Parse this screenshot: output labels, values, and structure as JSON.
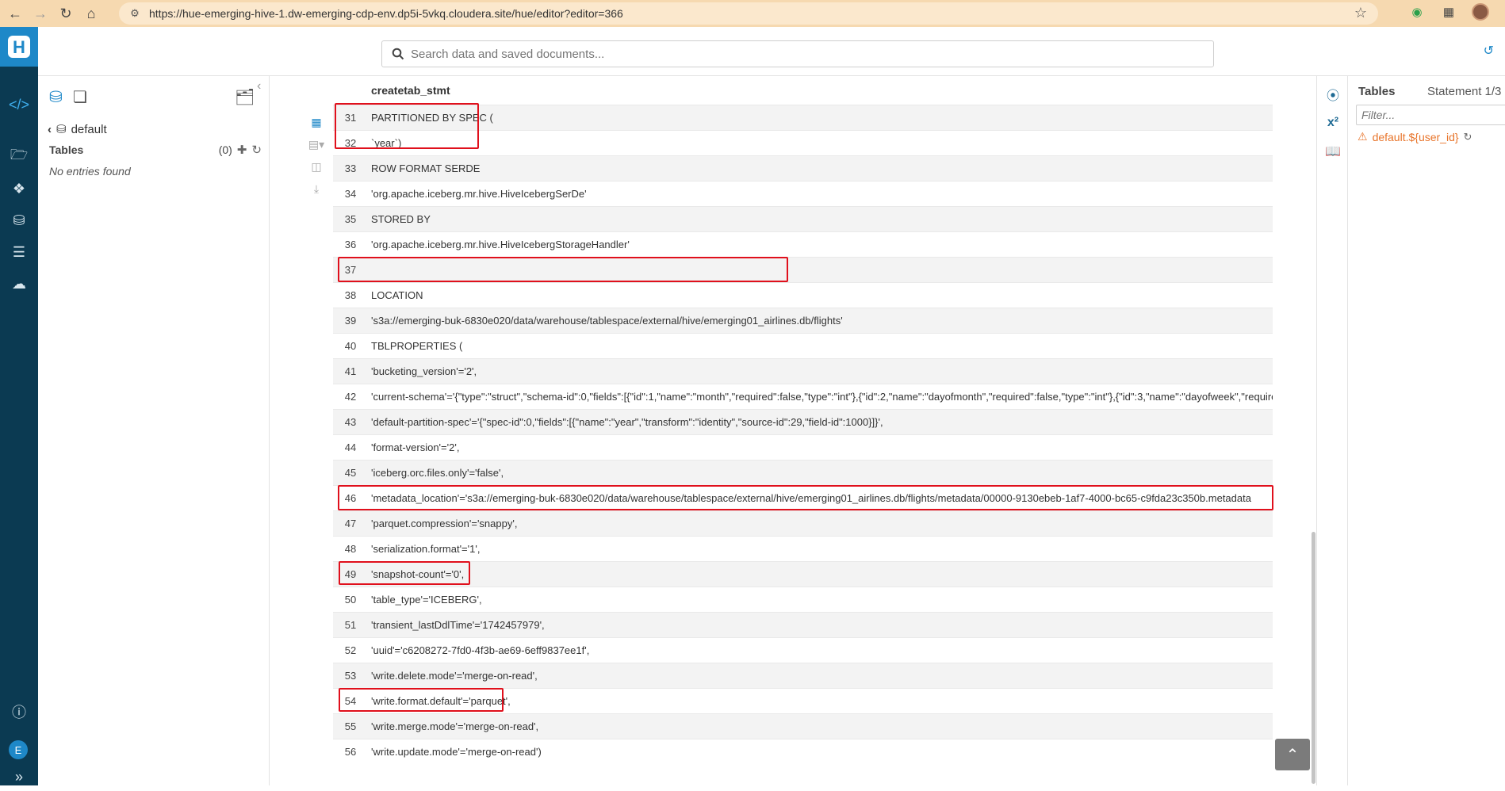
{
  "browser": {
    "url": "https://hue-emerging-hive-1.dw-emerging-cdp-env.dp5i-5vkq.cloudera.site/hue/editor?editor=366"
  },
  "topbar": {
    "search_placeholder": "Search data and saved documents..."
  },
  "assist": {
    "database": "default",
    "tables_label": "Tables",
    "tables_count": "(0)",
    "empty_text": "No entries found"
  },
  "result": {
    "column_header": "createtab_stmt",
    "rows": [
      {
        "num": "31",
        "value": "PARTITIONED BY SPEC ("
      },
      {
        "num": "32",
        "value": "`year`)"
      },
      {
        "num": "33",
        "value": "ROW FORMAT SERDE"
      },
      {
        "num": "34",
        "value": "'org.apache.iceberg.mr.hive.HiveIcebergSerDe'"
      },
      {
        "num": "35",
        "value": "STORED BY"
      },
      {
        "num": "36",
        "value": "'org.apache.iceberg.mr.hive.HiveIcebergStorageHandler'"
      },
      {
        "num": "37",
        "value": ""
      },
      {
        "num": "38",
        "value": "LOCATION"
      },
      {
        "num": "39",
        "value": "'s3a://emerging-buk-6830e020/data/warehouse/tablespace/external/hive/emerging01_airlines.db/flights'"
      },
      {
        "num": "40",
        "value": "TBLPROPERTIES ("
      },
      {
        "num": "41",
        "value": "'bucketing_version'='2',"
      },
      {
        "num": "42",
        "value": "'current-schema'='{\"type\":\"struct\",\"schema-id\":0,\"fields\":[{\"id\":1,\"name\":\"month\",\"required\":false,\"type\":\"int\"},{\"id\":2,\"name\":\"dayofmonth\",\"required\":false,\"type\":\"int\"},{\"id\":3,\"name\":\"dayofweek\",\"required\":fal"
      },
      {
        "num": "43",
        "value": "'default-partition-spec'='{\"spec-id\":0,\"fields\":[{\"name\":\"year\",\"transform\":\"identity\",\"source-id\":29,\"field-id\":1000}]}',"
      },
      {
        "num": "44",
        "value": "'format-version'='2',"
      },
      {
        "num": "45",
        "value": "'iceberg.orc.files.only'='false',"
      },
      {
        "num": "46",
        "value": "'metadata_location'='s3a://emerging-buk-6830e020/data/warehouse/tablespace/external/hive/emerging01_airlines.db/flights/metadata/00000-9130ebeb-1af7-4000-bc65-c9fda23c350b.metadata"
      },
      {
        "num": "47",
        "value": "'parquet.compression'='snappy',"
      },
      {
        "num": "48",
        "value": "'serialization.format'='1',"
      },
      {
        "num": "49",
        "value": "'snapshot-count'='0',"
      },
      {
        "num": "50",
        "value": "'table_type'='ICEBERG',"
      },
      {
        "num": "51",
        "value": "'transient_lastDdlTime'='1742457979',"
      },
      {
        "num": "52",
        "value": "'uuid'='c6208272-7fd0-4f3b-ae69-6eff9837ee1f',"
      },
      {
        "num": "53",
        "value": "'write.delete.mode'='merge-on-read',"
      },
      {
        "num": "54",
        "value": "'write.format.default'='parquet',"
      },
      {
        "num": "55",
        "value": "'write.merge.mode'='merge-on-read',"
      },
      {
        "num": "56",
        "value": "'write.update.mode'='merge-on-read')"
      }
    ]
  },
  "right_panel": {
    "title": "Tables",
    "statement": "Statement 1/3",
    "filter_placeholder": "Filter...",
    "entry": "default.${user_id}"
  },
  "rail": {
    "user_initial": "E"
  },
  "colors": {
    "rail_bg": "#0b3a52",
    "accent": "#1e88c8",
    "highlight": "#e0101c",
    "browser_bar": "#f6d9b0",
    "warning": "#e8742a"
  }
}
